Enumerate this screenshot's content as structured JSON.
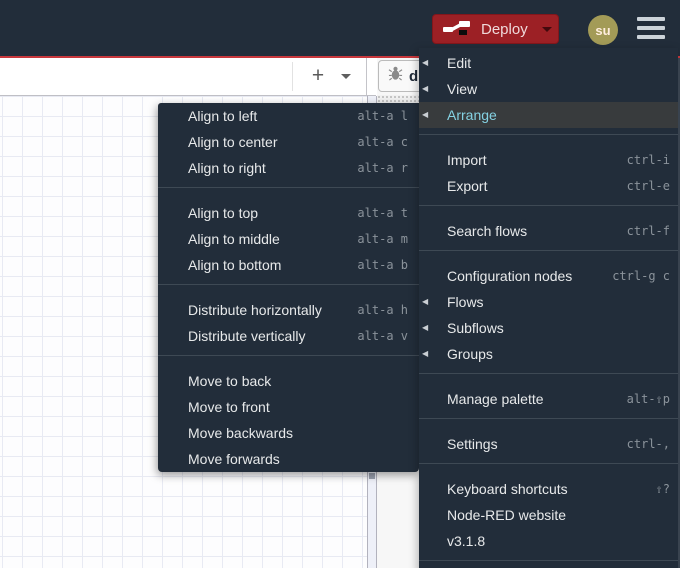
{
  "header": {
    "deploy_label": "Deploy",
    "user_initials": "su"
  },
  "colors": {
    "header_bg": "#222d3a",
    "accent_red": "#c9373c",
    "deploy_red": "#9c2025",
    "menu_bg": "#222d3a",
    "menu_highlight_bg": "#383b3d",
    "menu_highlight_text": "#85d2e3",
    "avatar_bg": "#a39b57",
    "grid_line": "#e8eaf3"
  },
  "menus": {
    "main": {
      "items": [
        {
          "id": "edit",
          "label": "Edit",
          "submenu": true
        },
        {
          "id": "view",
          "label": "View",
          "submenu": true
        },
        {
          "id": "arrange",
          "label": "Arrange",
          "submenu": true,
          "active": true
        },
        {
          "type": "separator"
        },
        {
          "id": "import",
          "label": "Import",
          "shortcut": "ctrl-i"
        },
        {
          "id": "export",
          "label": "Export",
          "shortcut": "ctrl-e"
        },
        {
          "type": "separator"
        },
        {
          "id": "search-flows",
          "label": "Search flows",
          "shortcut": "ctrl-f"
        },
        {
          "type": "separator"
        },
        {
          "id": "configuration-nodes",
          "label": "Configuration nodes",
          "shortcut": "ctrl-g c"
        },
        {
          "id": "flows",
          "label": "Flows",
          "submenu": true
        },
        {
          "id": "subflows",
          "label": "Subflows",
          "submenu": true
        },
        {
          "id": "groups",
          "label": "Groups",
          "submenu": true
        },
        {
          "type": "separator"
        },
        {
          "id": "manage-palette",
          "label": "Manage palette",
          "shortcut": "alt-⇧p"
        },
        {
          "type": "separator"
        },
        {
          "id": "settings",
          "label": "Settings",
          "shortcut": "ctrl-,"
        },
        {
          "type": "separator"
        },
        {
          "id": "keyboard-shortcuts",
          "label": "Keyboard shortcuts",
          "shortcut": "⇧?"
        },
        {
          "id": "node-red-website",
          "label": "Node-RED website"
        },
        {
          "id": "version",
          "label": "v3.1.8"
        },
        {
          "type": "separator"
        }
      ]
    },
    "arrange": {
      "items": [
        {
          "id": "align-to-left",
          "label": "Align to left",
          "shortcut": "alt-a l"
        },
        {
          "id": "align-to-center",
          "label": "Align to center",
          "shortcut": "alt-a c"
        },
        {
          "id": "align-to-right",
          "label": "Align to right",
          "shortcut": "alt-a r"
        },
        {
          "type": "separator"
        },
        {
          "id": "align-to-top",
          "label": "Align to top",
          "shortcut": "alt-a t"
        },
        {
          "id": "align-to-middle",
          "label": "Align to middle",
          "shortcut": "alt-a m"
        },
        {
          "id": "align-to-bottom",
          "label": "Align to bottom",
          "shortcut": "alt-a b"
        },
        {
          "type": "separator"
        },
        {
          "id": "distribute-horizontally",
          "label": "Distribute horizontally",
          "shortcut": "alt-a h"
        },
        {
          "id": "distribute-vertically",
          "label": "Distribute vertically",
          "shortcut": "alt-a v"
        },
        {
          "type": "separator"
        },
        {
          "id": "move-to-back",
          "label": "Move to back"
        },
        {
          "id": "move-to-front",
          "label": "Move to front"
        },
        {
          "id": "move-backwards",
          "label": "Move backwards"
        },
        {
          "id": "move-forwards",
          "label": "Move forwards"
        }
      ]
    }
  }
}
